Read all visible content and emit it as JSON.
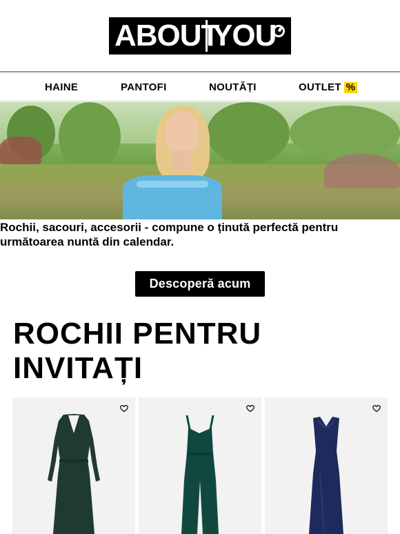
{
  "logo": {
    "part1": "ABOUT",
    "part2": "YOU",
    "icon": "about-you-logo-mark"
  },
  "nav": {
    "items": [
      {
        "label": "HAINE"
      },
      {
        "label": "PANTOFI"
      },
      {
        "label": "NOUTĂȚI"
      },
      {
        "label": "OUTLET",
        "badge": "%"
      }
    ],
    "badge_color": "#ffd500"
  },
  "hero": {
    "description_colors": {
      "top": "#5fb6e0",
      "grass": "#8fa84f"
    }
  },
  "tagline": "Rochii, sacouri, accesorii - compune o ținută perfectă pentru următoarea nuntă din calendar.",
  "cta": {
    "label": "Descoperă acum"
  },
  "section": {
    "title": "ROCHII PENTRU INVITAȚI"
  },
  "products": [
    {
      "icon": "heart-icon",
      "color": "#1f3a33"
    },
    {
      "icon": "heart-icon",
      "color": "#10483f"
    },
    {
      "icon": "heart-icon",
      "color": "#1f2a5c"
    }
  ]
}
